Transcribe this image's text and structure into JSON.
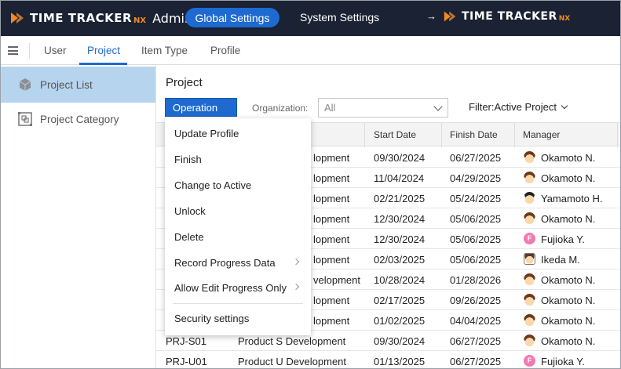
{
  "header": {
    "logo_text": "TIME TRACKER",
    "logo_suffix": "NX",
    "admin_label": "Admin",
    "global_settings": "Global Settings",
    "system_settings": "System Settings",
    "arrow": "→",
    "product_logo_text": "TIME TRACKER",
    "product_logo_suffix": "NX",
    "accent_color": "#1e6ad0",
    "logo_color": "#f08a24"
  },
  "tabs": [
    {
      "label": "User"
    },
    {
      "label": "Project",
      "active": true
    },
    {
      "label": "Item Type"
    },
    {
      "label": "Profile"
    }
  ],
  "sidebar": {
    "items": [
      {
        "label": "Project List",
        "icon": "cube-icon",
        "active": true
      },
      {
        "label": "Project Category",
        "icon": "category-icon"
      }
    ]
  },
  "main": {
    "title": "Project",
    "operation_label": "Operation",
    "organization_label": "Organization:",
    "organization_value": "All",
    "filter_label": "Filter:Active Project"
  },
  "table": {
    "columns": [
      "Start Date",
      "Finish Date",
      "Manager"
    ],
    "rows": [
      {
        "code": "",
        "name": "Product A Development",
        "name_visible": "lopment",
        "start": "09/30/2024",
        "finish": "06/27/2025",
        "manager": "Okamoto N.",
        "avatar": "m1"
      },
      {
        "code": "",
        "name": "",
        "name_visible": "lopment",
        "start": "11/04/2024",
        "finish": "04/29/2025",
        "manager": "Okamoto N.",
        "avatar": "m1"
      },
      {
        "code": "",
        "name": "",
        "name_visible": "lopment",
        "start": "02/21/2025",
        "finish": "05/24/2025",
        "manager": "Yamamoto H.",
        "avatar": "m2"
      },
      {
        "code": "",
        "name": "",
        "name_visible": "lopment",
        "start": "12/30/2024",
        "finish": "05/06/2025",
        "manager": "Okamoto N.",
        "avatar": "m1"
      },
      {
        "code": "",
        "name": "",
        "name_visible": "lopment",
        "start": "12/30/2024",
        "finish": "05/06/2025",
        "manager": "Fujioka Y.",
        "avatar": "f"
      },
      {
        "code": "",
        "name": "",
        "name_visible": "lopment",
        "start": "02/03/2025",
        "finish": "05/06/2025",
        "manager": "Ikeda M.",
        "avatar": "m3"
      },
      {
        "code": "",
        "name": "",
        "name_visible": "velopment",
        "start": "10/28/2024",
        "finish": "01/28/2026",
        "manager": "Okamoto N.",
        "avatar": "m1"
      },
      {
        "code": "",
        "name": "",
        "name_visible": "lopment",
        "start": "02/17/2025",
        "finish": "09/26/2025",
        "manager": "Okamoto N.",
        "avatar": "m1"
      },
      {
        "code": "",
        "name": "",
        "name_visible": "lopment",
        "start": "01/02/2025",
        "finish": "04/04/2025",
        "manager": "Okamoto N.",
        "avatar": "m1"
      },
      {
        "code": "PRJ-S01",
        "name_visible": "Product S Development",
        "start": "09/30/2024",
        "finish": "06/27/2025",
        "manager": "Okamoto N.",
        "avatar": "m1"
      },
      {
        "code": "PRJ-U01",
        "name_visible": "Product U Development",
        "start": "01/13/2025",
        "finish": "06/27/2025",
        "manager": "Fujioka Y.",
        "avatar": "f"
      }
    ]
  },
  "menu": {
    "items": [
      {
        "label": "Update Profile"
      },
      {
        "label": "Finish"
      },
      {
        "label": "Change to Active"
      },
      {
        "label": "Unlock"
      },
      {
        "label": "Delete"
      },
      {
        "label": "Record Progress Data",
        "submenu": true
      },
      {
        "label": "Allow Edit Progress Only",
        "submenu": true
      },
      {
        "label": "Security settings"
      }
    ]
  },
  "avatar_initial_f": "F"
}
